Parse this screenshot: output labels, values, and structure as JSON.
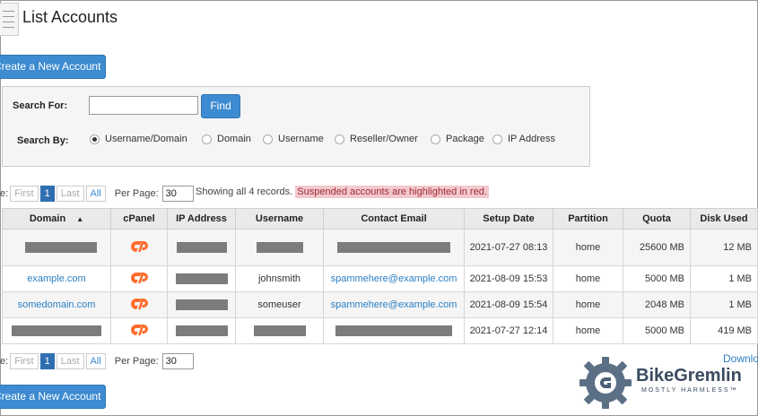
{
  "page": {
    "title": "List Accounts"
  },
  "buttons": {
    "create_account": "Create a New Account",
    "find": "Find"
  },
  "search": {
    "search_for_label": "Search For:",
    "search_by_label": "Search By:",
    "value": "",
    "options": [
      {
        "label": "Username/Domain",
        "selected": true
      },
      {
        "label": "Domain",
        "selected": false
      },
      {
        "label": "Username",
        "selected": false
      },
      {
        "label": "Reseller/Owner",
        "selected": false
      },
      {
        "label": "Package",
        "selected": false
      },
      {
        "label": "IP Address",
        "selected": false
      }
    ]
  },
  "pager": {
    "page_label": "e:",
    "first": "First",
    "current": "1",
    "last": "Last",
    "all": "All",
    "per_page_label": "Per Page:",
    "per_page_value": "30"
  },
  "status": {
    "showing": "Showing all 4 records.",
    "suspended_note": "Suspended accounts are highlighted in red."
  },
  "table": {
    "headers": [
      "Domain",
      "cPanel",
      "IP Address",
      "Username",
      "Contact Email",
      "Setup Date",
      "Partition",
      "Quota",
      "Disk Used"
    ],
    "rows": [
      {
        "domain": "",
        "ip": "",
        "username": "",
        "email": "",
        "setup": "2021-07-27 08:13",
        "partition": "home",
        "quota": "25600 MB",
        "disk": "12 MB"
      },
      {
        "domain": "example.com",
        "ip": "",
        "username": "johnsmith",
        "email": "spammehere@example.com",
        "setup": "2021-08-09 15:53",
        "partition": "home",
        "quota": "5000 MB",
        "disk": "1 MB"
      },
      {
        "domain": "somedomain.com",
        "ip": "",
        "username": "someuser",
        "email": "spammehere@example.com",
        "setup": "2021-08-09 15:54",
        "partition": "home",
        "quota": "2048 MB",
        "disk": "1 MB"
      },
      {
        "domain": "",
        "ip": "",
        "username": "",
        "email": "",
        "setup": "2021-07-27 12:14",
        "partition": "home",
        "quota": "5000 MB",
        "disk": "419 MB"
      }
    ]
  },
  "footer": {
    "download": "Downlo"
  },
  "watermark": {
    "brand": "BikeGremlin",
    "tagline": "MOSTLY HARMLESS™"
  },
  "colors": {
    "accent": "#3d8bd0",
    "cpanel_orange": "#ff6c2c",
    "suspended_bg": "#f2c9cd"
  }
}
